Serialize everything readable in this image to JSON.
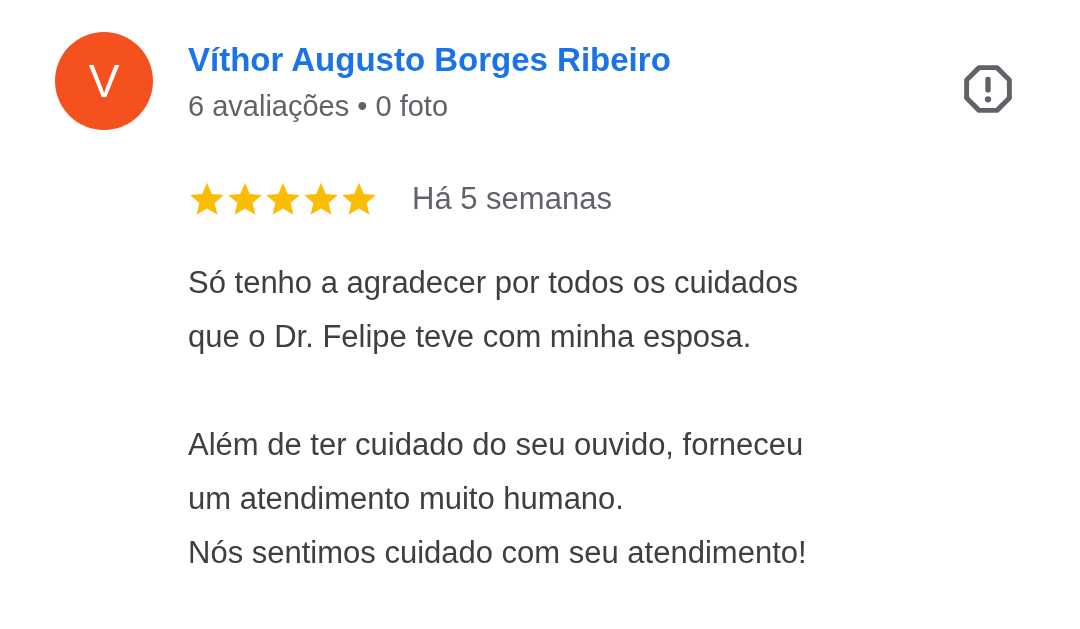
{
  "review": {
    "avatar_letter": "V",
    "author": "Víthor Augusto Borges Ribeiro",
    "meta": "6 avaliações • 0 foto",
    "stars": 5,
    "time": "Há 5 semanas",
    "paragraphs": [
      [
        "Só tenho a agradecer por todos os cuidados",
        "que o Dr. Felipe teve com minha esposa."
      ],
      [
        "Além de ter cuidado do seu ouvido, forneceu",
        "um atendimento muito humano.",
        "Nós sentimos cuidado com seu atendimento!"
      ]
    ]
  }
}
